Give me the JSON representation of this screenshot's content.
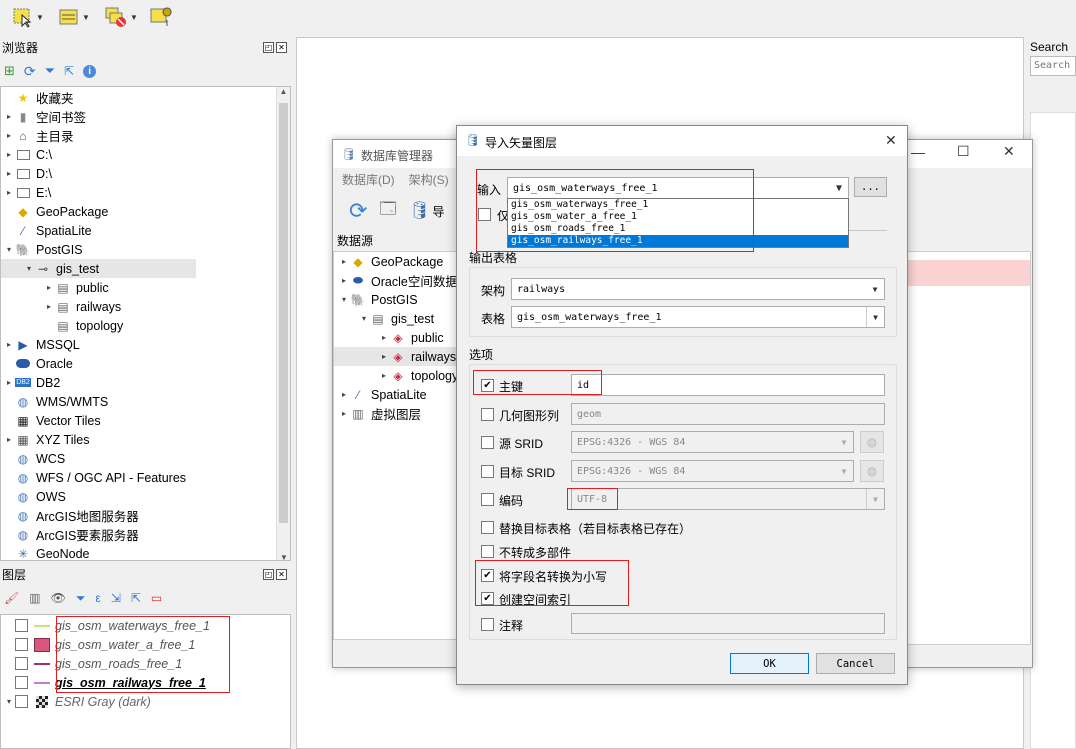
{
  "browser_panel": {
    "title": "浏览器",
    "items": [
      {
        "label": "收藏夹",
        "icon": "star-icon"
      },
      {
        "label": "空间书签",
        "icon": "bookmark-icon"
      },
      {
        "label": "主目录",
        "icon": "home-icon"
      },
      {
        "label": "C:\\",
        "icon": "folder-icon"
      },
      {
        "label": "D:\\",
        "icon": "folder-icon"
      },
      {
        "label": "E:\\",
        "icon": "folder-icon"
      },
      {
        "label": "GeoPackage",
        "icon": "geopackage-icon"
      },
      {
        "label": "SpatiaLite",
        "icon": "spatialite-icon"
      },
      {
        "label": "PostGIS",
        "icon": "postgis-icon"
      },
      {
        "label": "gis_test",
        "icon": "connection-icon"
      },
      {
        "label": "public",
        "icon": "schema-icon"
      },
      {
        "label": "railways",
        "icon": "schema-icon"
      },
      {
        "label": "topology",
        "icon": "schema-icon"
      },
      {
        "label": "MSSQL",
        "icon": "mssql-icon"
      },
      {
        "label": "Oracle",
        "icon": "oracle-icon"
      },
      {
        "label": "DB2",
        "icon": "db2-icon"
      },
      {
        "label": "WMS/WMTS",
        "icon": "globe-icon"
      },
      {
        "label": "Vector Tiles",
        "icon": "vector-tiles-icon"
      },
      {
        "label": "XYZ Tiles",
        "icon": "xyz-tiles-icon"
      },
      {
        "label": "WCS",
        "icon": "globe-icon"
      },
      {
        "label": "WFS / OGC API - Features",
        "icon": "globe-icon"
      },
      {
        "label": "OWS",
        "icon": "globe-icon"
      },
      {
        "label": "ArcGIS地图服务器",
        "icon": "globe-icon"
      },
      {
        "label": "ArcGIS要素服务器",
        "icon": "globe-icon"
      },
      {
        "label": "GeoNode",
        "icon": "geonode-icon"
      }
    ]
  },
  "layers_panel": {
    "title": "图层",
    "layers": [
      {
        "name": "gis_osm_waterways_free_1",
        "color": "#c9e27a"
      },
      {
        "name": "gis_osm_water_a_free_1",
        "color": "#d9567e"
      },
      {
        "name": "gis_osm_roads_free_1",
        "color": "#a0306e"
      },
      {
        "name": "gis_osm_railways_free_1",
        "color": "#c080d0"
      },
      {
        "name": "ESRI Gray (dark)",
        "color": "#444444"
      }
    ]
  },
  "search_panel": {
    "title": "Search",
    "placeholder": "Search"
  },
  "db_manager": {
    "title": "数据库管理器",
    "menu": [
      "数据库(D)",
      "架构(S)"
    ],
    "toolbar_partial": "导",
    "tree_header": "数据源",
    "items": [
      {
        "label": "GeoPackage"
      },
      {
        "label": "Oracle空间数据"
      },
      {
        "label": "PostGIS"
      },
      {
        "label": "gis_test"
      },
      {
        "label": "public"
      },
      {
        "label": "railways"
      },
      {
        "label": "topology"
      },
      {
        "label": "SpatiaLite"
      },
      {
        "label": "虚拟图层"
      }
    ]
  },
  "import_dialog": {
    "title": "导入矢量图层",
    "input_label": "输入",
    "input_value": "gis_osm_waterways_free_1",
    "browse_label": "...",
    "only_selected_partial": "仅",
    "dropdown_options": [
      "gis_osm_waterways_free_1",
      "gis_osm_water_a_free_1",
      "gis_osm_roads_free_1",
      "gis_osm_railways_free_1"
    ],
    "dropdown_selected_index": 3,
    "output_section": "输出表格",
    "schema_label": "架构",
    "schema_value": "railways",
    "table_label": "表格",
    "table_value": "gis_osm_waterways_free_1",
    "options_section": "选项",
    "primary_key_label": "主键",
    "primary_key_value": "id",
    "geom_col_label": "几何图形列",
    "geom_col_value": "geom",
    "source_srid_label": "源 SRID",
    "source_srid_value": "EPSG:4326 - WGS 84",
    "target_srid_label": "目标 SRID",
    "target_srid_value": "EPSG:4326 - WGS 84",
    "encoding_label": "编码",
    "encoding_value": "UTF-8",
    "replace_label": "替换目标表格（若目标表格已存在）",
    "no_multipart_label": "不转成多部件",
    "lowercase_label": "将字段名转换为小写",
    "spatial_index_label": "创建空间索引",
    "comment_label": "注释",
    "ok_label": "OK",
    "cancel_label": "Cancel",
    "checked": {
      "primary_key": true,
      "geom_col": false,
      "source_srid": false,
      "target_srid": false,
      "encoding": false,
      "replace": false,
      "no_multipart": false,
      "lowercase": true,
      "spatial_index": true,
      "comment": false
    }
  }
}
